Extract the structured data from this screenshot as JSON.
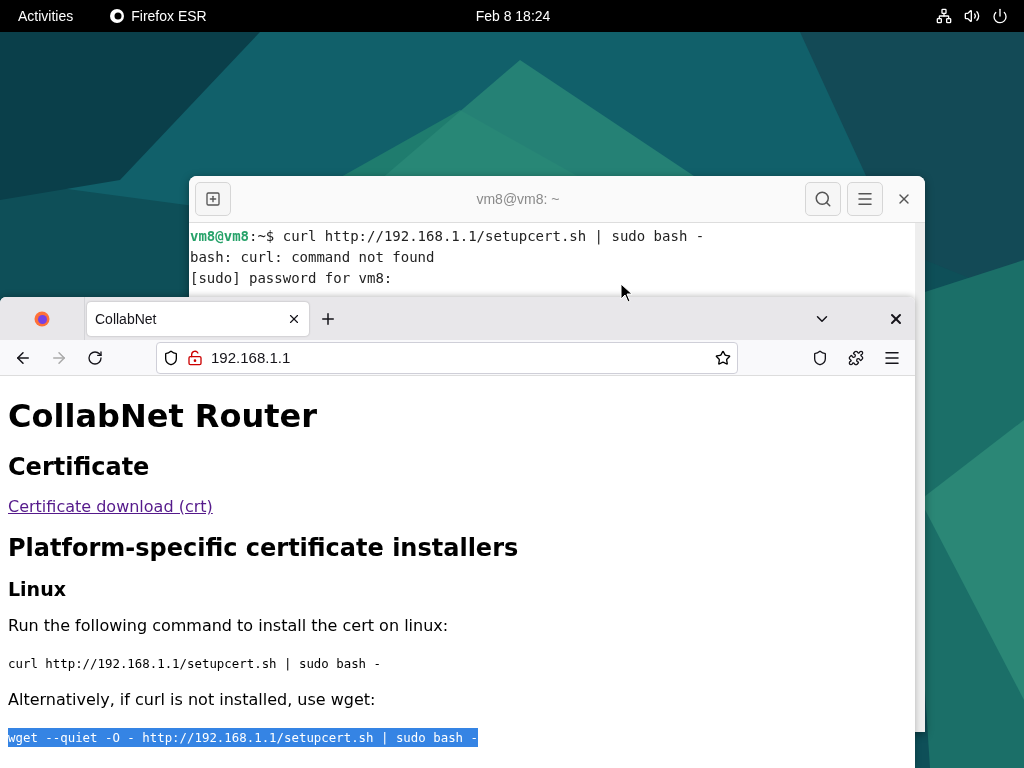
{
  "top_bar": {
    "activities": "Activities",
    "app_name": "Firefox ESR",
    "clock": "Feb 8  18:24"
  },
  "terminal": {
    "title": "vm8@vm8: ~",
    "lines": [
      {
        "kind": "command",
        "user": "vm8@vm8",
        "text": ":~$ curl http://192.168.1.1/setupcert.sh | sudo bash -"
      },
      {
        "kind": "output",
        "text": "bash: curl: command not found"
      },
      {
        "kind": "output",
        "text": "[sudo] password for vm8:"
      }
    ]
  },
  "browser": {
    "tabs": [
      {
        "title": "CollabNet",
        "selected": true
      }
    ],
    "url": "192.168.1.1",
    "page": [
      {
        "kind": "h1",
        "text": "CollabNet Router"
      },
      {
        "kind": "h2",
        "text": "Certificate"
      },
      {
        "kind": "link",
        "text": "Certificate download (crt)"
      },
      {
        "kind": "h2",
        "text": "Platform-specific certificate installers"
      },
      {
        "kind": "h3",
        "text": "Linux"
      },
      {
        "kind": "p",
        "text": "Run the following command to install the cert on linux:"
      },
      {
        "kind": "code",
        "text": "curl http://192.168.1.1/setupcert.sh | sudo bash -",
        "selected": false
      },
      {
        "kind": "p",
        "text": "Alternatively, if curl is not installed, use wget:"
      },
      {
        "kind": "code",
        "text": "wget --quiet -O - http://192.168.1.1/setupcert.sh | sudo bash -",
        "selected": true
      }
    ]
  }
}
